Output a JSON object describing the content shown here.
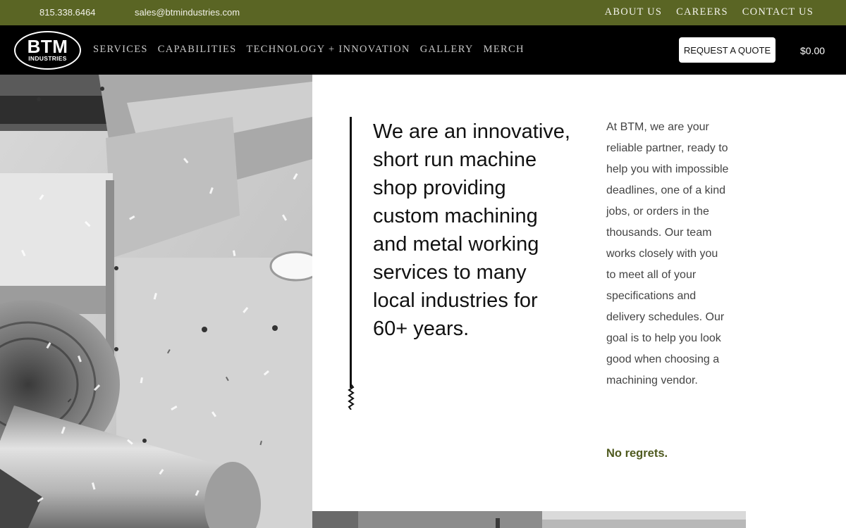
{
  "topbar": {
    "phone": "815.338.6464",
    "email": "sales@btmindustries.com",
    "links": [
      "ABOUT US",
      "CAREERS",
      "CONTACT US"
    ]
  },
  "nav": {
    "logo_main": "BTM",
    "logo_sub": "INDUSTRIES",
    "items": [
      "SERVICES",
      "CAPABILITIES",
      "TECHNOLOGY + INNOVATION",
      "GALLERY",
      "MERCH"
    ],
    "quote_button": "REQUEST A QUOTE",
    "cart_total": "$0.00"
  },
  "hero": {
    "headline": "We are an innovative, short run machine shop providing custom machining and metal working services to many local industries for 60+ years.",
    "paragraph": "At BTM, we are your reliable partner, ready to help you with impossible deadlines, one of a kind jobs, or orders in the thousands. Our team works closely with you to meet all of your specifications and delivery schedules. Our goal is to help you look good when choosing a machining vendor.",
    "tagline": "No regrets."
  },
  "colors": {
    "topbar_bg": "#5a6524",
    "nav_bg": "#000000",
    "accent_text": "#4f5a1f"
  }
}
